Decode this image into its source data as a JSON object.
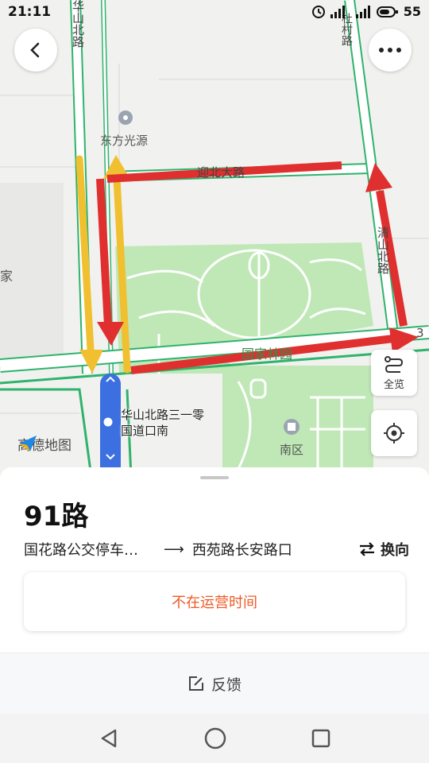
{
  "status_bar": {
    "time": "21:11",
    "battery": "55",
    "network": "4G"
  },
  "map": {
    "poi_dongfang": "东方光源",
    "poi_jia": "家",
    "poi_nanqu": "南区",
    "road_huashan_top": "华山北路",
    "road_duncun": "杜村路",
    "road_top_horizontal": "迎北大路",
    "road_east_vertical": "清山北路",
    "park_name": "国家林园",
    "edge_number": "3",
    "stop_name_line1": "华山北路三一零",
    "stop_name_line2": "国道口南",
    "logo_text": "高德地图",
    "overview_label": "全览",
    "colors": {
      "route_red": "#e02f2f",
      "route_yellow": "#f0c030",
      "route_blue": "#3c6fe0",
      "park_green": "#bfe8b6",
      "road_green": "#2fb36c"
    }
  },
  "sheet": {
    "route_name": "91路",
    "from": "国花路公交停车…",
    "to": "西苑路长安路口",
    "switch_label": "换向",
    "status": "不在运营时间",
    "feedback_label": "反馈"
  }
}
